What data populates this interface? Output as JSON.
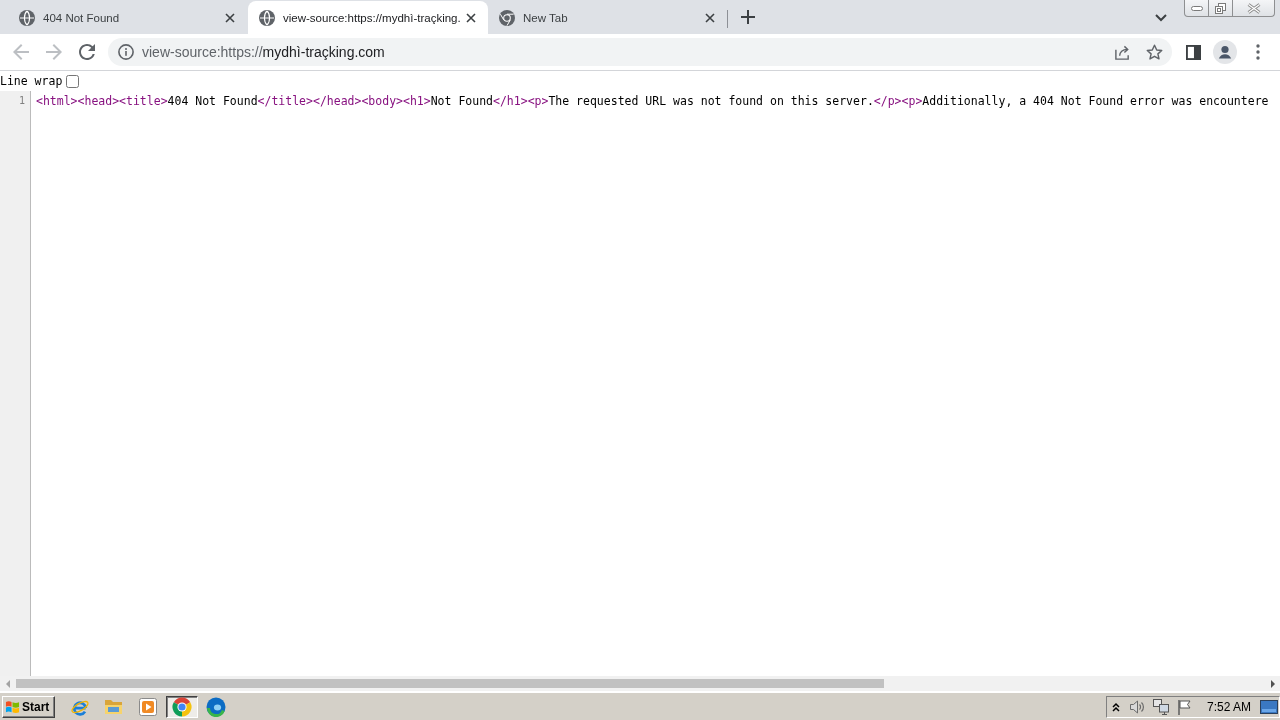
{
  "browser": {
    "tabs": [
      {
        "title": "404 Not Found",
        "kind": "site",
        "selected": false
      },
      {
        "title": "view-source:https://mydhì-traçking.",
        "kind": "site",
        "selected": true
      },
      {
        "title": "New Tab",
        "kind": "home",
        "selected": false
      }
    ],
    "address_bar": {
      "scheme": "view-source:https://",
      "host": "mydhì-traçking.com"
    }
  },
  "source_view": {
    "line_wrap": {
      "label": "Line wrap",
      "checked": false
    },
    "lines": [
      {
        "number": "1",
        "tokens": [
          {
            "kind": "tag",
            "text": "<html>"
          },
          {
            "kind": "tag",
            "text": "<head>"
          },
          {
            "kind": "tag",
            "text": "<title>"
          },
          {
            "kind": "text",
            "text": "404 Not Found"
          },
          {
            "kind": "tag",
            "text": "</title>"
          },
          {
            "kind": "tag",
            "text": "</head>"
          },
          {
            "kind": "tag",
            "text": "<body>"
          },
          {
            "kind": "tag",
            "text": "<h1>"
          },
          {
            "kind": "text",
            "text": "Not Found"
          },
          {
            "kind": "tag",
            "text": "</h1>"
          },
          {
            "kind": "tag",
            "text": "<p>"
          },
          {
            "kind": "text",
            "text": "The requested URL was not found on this server."
          },
          {
            "kind": "tag",
            "text": "</p>"
          },
          {
            "kind": "tag",
            "text": "<p>"
          },
          {
            "kind": "text",
            "text": "Additionally, a 404 Not Found error was encountere"
          }
        ]
      }
    ]
  },
  "taskbar": {
    "start": "Start",
    "apps": [
      {
        "kind": "e",
        "selected": false
      },
      {
        "kind": "folder",
        "selected": false
      },
      {
        "kind": "player",
        "selected": false
      },
      {
        "kind": "ring",
        "selected": true
      },
      {
        "kind": "wave",
        "selected": false
      }
    ],
    "clock": "7:52 AM"
  }
}
